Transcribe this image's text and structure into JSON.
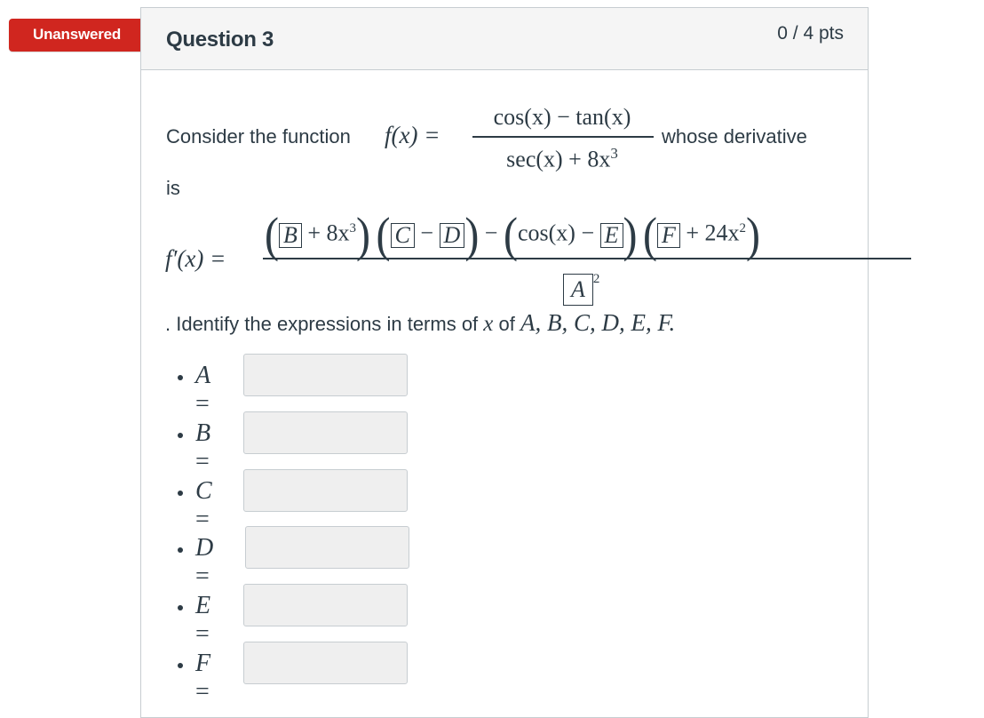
{
  "status_flag": "Unanswered",
  "question": {
    "title": "Question 3",
    "points": "0 / 4 pts"
  },
  "prompt": {
    "intro": "Consider the function",
    "f_lhs": "f(x) =",
    "numerator": "cos(x) − tan(x)",
    "denominator_text": "sec(x) + 8x",
    "denominator_exp": "3",
    "after": "whose derivative",
    "is": "is",
    "fprime_lhs": "f′(x) =",
    "identify_prefix": ". Identify the expressions in terms of",
    "identify_var": "x",
    "identify_of": "of",
    "identify_list": "A, B, C, D, E, F."
  },
  "derivative": {
    "box_A": "A",
    "box_B": "B",
    "box_C": "C",
    "box_D": "D",
    "box_E": "E",
    "box_F": "F",
    "plus_8x": "+ 8x",
    "exp3": "3",
    "minus": "−",
    "cos_x": "cos(x)",
    "plus_24x": "+ 24x",
    "exp2": "2",
    "denom_exp": "2"
  },
  "answers": [
    {
      "var": "A",
      "eq": "=",
      "value": ""
    },
    {
      "var": "B",
      "eq": "=",
      "value": ""
    },
    {
      "var": "C",
      "eq": "=",
      "value": ""
    },
    {
      "var": "D",
      "eq": "=",
      "value": ""
    },
    {
      "var": "E",
      "eq": "=",
      "value": ""
    },
    {
      "var": "F",
      "eq": "=",
      "value": ""
    }
  ]
}
